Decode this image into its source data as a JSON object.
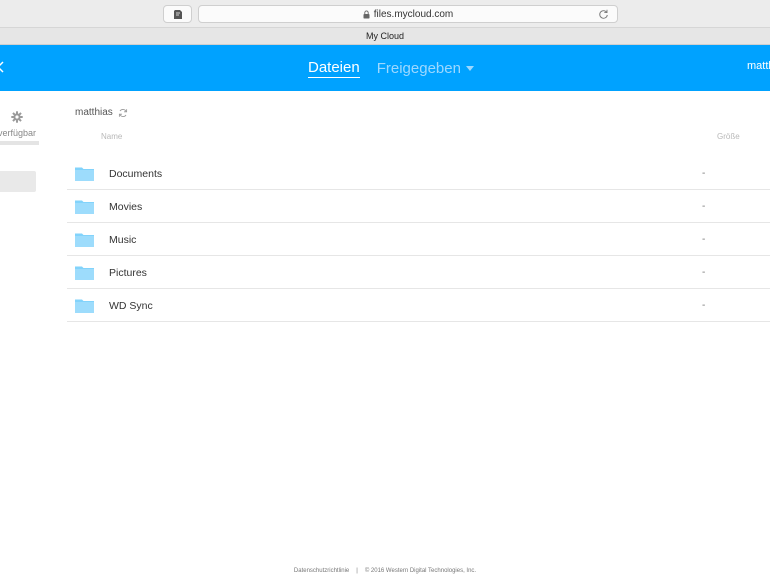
{
  "browser": {
    "url": "files.mycloud.com",
    "tab_title": "My Cloud"
  },
  "header": {
    "tabs": [
      {
        "label": "Dateien"
      },
      {
        "label": "Freigegeben"
      }
    ],
    "user": "matth"
  },
  "sidebar": {
    "storage_label": "verfügbar"
  },
  "main": {
    "breadcrumb": "matthias",
    "columns": {
      "name": "Name",
      "size": "Größe"
    },
    "files": [
      {
        "name": "Documents",
        "size": "-"
      },
      {
        "name": "Movies",
        "size": "-"
      },
      {
        "name": "Music",
        "size": "-"
      },
      {
        "name": "Pictures",
        "size": "-"
      },
      {
        "name": "WD Sync",
        "size": "-"
      }
    ]
  },
  "footer": {
    "privacy": "Datenschutzrichtlinie",
    "separator": "|",
    "copyright": "© 2016 Western Digital Technologies, Inc."
  },
  "colors": {
    "header_bg": "#00a2ff",
    "folder": "#82d3fb",
    "inactive_tab": "#9dd8ff"
  }
}
